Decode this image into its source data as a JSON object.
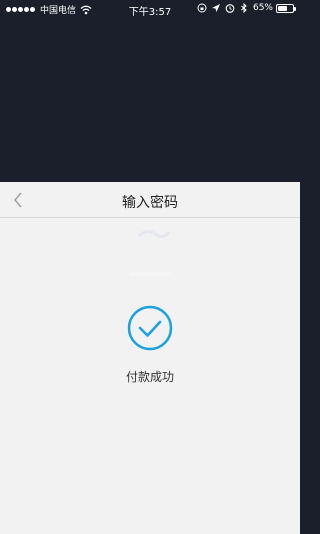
{
  "status_bar": {
    "carrier": "中国电信",
    "time": "下午3:57",
    "battery": "65%",
    "battery_level": 0.65,
    "icons": [
      "signal-dots-icon",
      "wifi-icon",
      "location-icon",
      "alarm-icon",
      "bluetooth-icon",
      "battery-icon"
    ]
  },
  "nav": {
    "title": "输入密码",
    "back_icon": "chevron-left-icon"
  },
  "result": {
    "icon": "check-circle-icon",
    "message": "付款成功"
  },
  "colors": {
    "background_top": "#1a1f2b",
    "sheet_background": "#f2f2f2",
    "accent": "#1aa1e0",
    "title_text": "#222222"
  }
}
